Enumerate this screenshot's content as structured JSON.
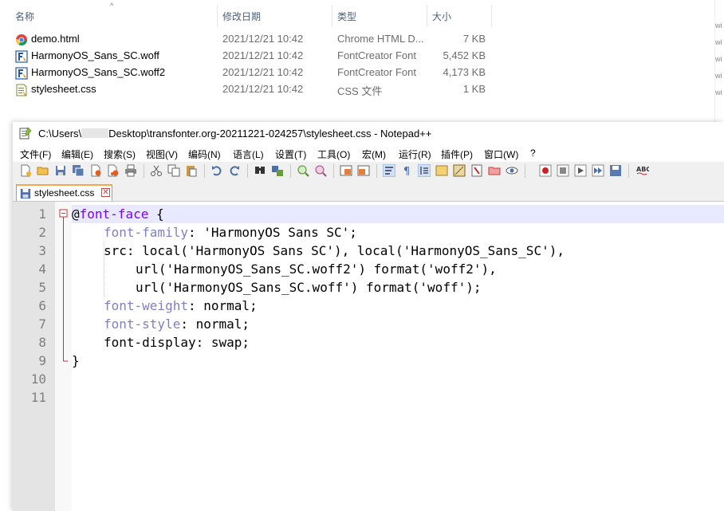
{
  "explorer": {
    "columns": {
      "name": "名称",
      "date": "修改日期",
      "type": "类型",
      "size": "大小"
    },
    "files": [
      {
        "name": "demo.html",
        "date": "2021/12/21 10:42",
        "type": "Chrome HTML D...",
        "size": "7 KB",
        "icon": "chrome-icon"
      },
      {
        "name": "HarmonyOS_Sans_SC.woff",
        "date": "2021/12/21 10:42",
        "type": "FontCreator Font",
        "size": "5,452 KB",
        "icon": "fontcreator-icon"
      },
      {
        "name": "HarmonyOS_Sans_SC.woff2",
        "date": "2021/12/21 10:42",
        "type": "FontCreator Font",
        "size": "4,173 KB",
        "icon": "fontcreator-icon"
      },
      {
        "name": "stylesheet.css",
        "date": "2021/12/21 10:42",
        "type": "CSS 文件",
        "size": "1 KB",
        "icon": "css-file-icon"
      }
    ]
  },
  "notepad": {
    "title_prefix": "C:\\Users\\",
    "title_suffix": "Desktop\\transfonter.org-20211221-024257\\stylesheet.css - Notepad++",
    "menu": [
      "文件(F)",
      "编辑(E)",
      "搜索(S)",
      "视图(V)",
      "编码(N)",
      "语言(L)",
      "设置(T)",
      "工具(O)",
      "宏(M)",
      "运行(R)",
      "插件(P)",
      "窗口(W)",
      "?"
    ],
    "tab_label": "stylesheet.css",
    "tab_close": "✕",
    "line_numbers": [
      "1",
      "2",
      "3",
      "4",
      "5",
      "6",
      "7",
      "8",
      "9",
      "10",
      "11"
    ],
    "code": {
      "l1_at": "@",
      "l1_sel": "font-face",
      "l1_rest": " {",
      "l2_prop": "font-family",
      "l2_rest": ": 'HarmonyOS Sans SC';",
      "l3": "src: local('HarmonyOS Sans SC'), local('HarmonyOS_Sans_SC'),",
      "l4": "url('HarmonyOS_Sans_SC.woff2') format('woff2'),",
      "l5": "url('HarmonyOS_Sans_SC.woff') format('woff');",
      "l6_prop": "font-weight",
      "l6_rest": ": normal;",
      "l7_prop": "font-style",
      "l7_rest": ": normal;",
      "l8": "font-display: swap;",
      "l9": "}"
    }
  }
}
